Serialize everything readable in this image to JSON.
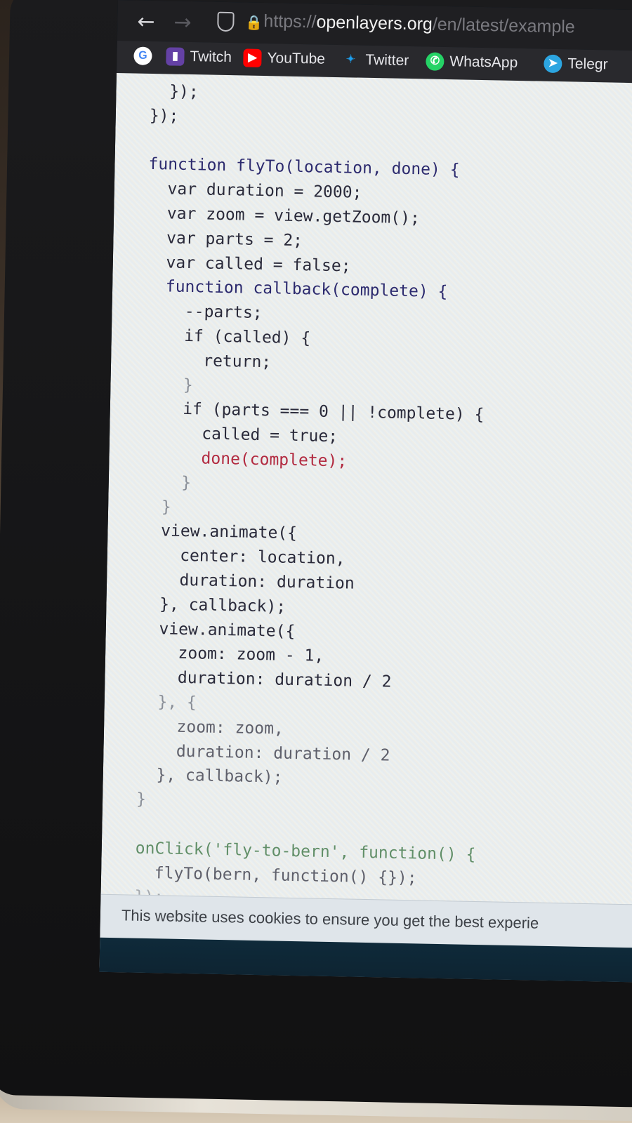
{
  "browser": {
    "url_protocol": "https://",
    "url_domain": "openlayers.org",
    "url_path": "/en/latest/example",
    "back_icon": "arrow-left-icon",
    "forward_icon": "arrow-right-icon"
  },
  "bookmarks": [
    {
      "label": "Twitch",
      "icon": "twitch-icon",
      "color": "#6441a5"
    },
    {
      "label": "YouTube",
      "icon": "youtube-icon",
      "color": "#ff0000"
    },
    {
      "label": "Twitter",
      "icon": "twitter-icon",
      "color": "#1da1f2"
    },
    {
      "label": "WhatsApp",
      "icon": "whatsapp-icon",
      "color": "#25d366"
    },
    {
      "label": "Telegr",
      "icon": "telegram-icon",
      "color": "#2ca5e0"
    }
  ],
  "code_lines": [
    "  });",
    "});",
    "",
    "function flyTo(location, done) {",
    "  var duration = 2000;",
    "  var zoom = view.getZoom();",
    "  var parts = 2;",
    "  var called = false;",
    "  function callback(complete) {",
    "    --parts;",
    "    if (called) {",
    "      return;",
    "    }",
    "    if (parts === 0 || !complete) {",
    "      called = true;",
    "      done(complete);",
    "    }",
    "  }",
    "  view.animate({",
    "    center: location,",
    "    duration: duration",
    "  }, callback);",
    "  view.animate({",
    "    zoom: zoom - 1,",
    "    duration: duration / 2",
    "  }, {",
    "    zoom: zoom,",
    "    duration: duration / 2",
    "  }, callback);",
    "}",
    "",
    "onClick('fly-to-bern', function() {",
    "  flyTo(bern, function() {});",
    "});"
  ],
  "cookie_banner": "This website uses cookies to ensure you get the best experie"
}
